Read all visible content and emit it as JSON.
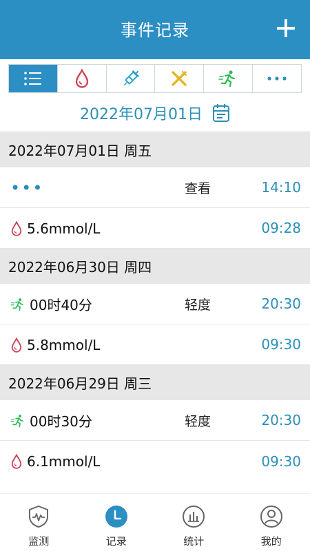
{
  "header": {
    "title": "事件记录",
    "add_icon": "plus-icon"
  },
  "tabs": [
    {
      "icon": "list-icon",
      "active": true
    },
    {
      "icon": "blood-drop-icon",
      "active": false
    },
    {
      "icon": "syringe-icon",
      "active": false
    },
    {
      "icon": "fork-knife-icon",
      "active": false
    },
    {
      "icon": "running-icon",
      "active": false
    },
    {
      "icon": "more-icon",
      "active": false
    }
  ],
  "date_picker": {
    "date": "2022年07月01日",
    "icon": "calendar-icon"
  },
  "days": [
    {
      "header": "2022年07月01日 周五",
      "items": [
        {
          "icon": "more-icon",
          "text": "•••",
          "mid": "查看",
          "time": "14:10"
        },
        {
          "icon": "blood-drop-icon",
          "text": "5.6mmol/L",
          "mid": "",
          "time": "09:28"
        }
      ]
    },
    {
      "header": "2022年06月30日 周四",
      "items": [
        {
          "icon": "running-icon",
          "text": "00时40分",
          "mid": "轻度",
          "time": "20:30"
        },
        {
          "icon": "blood-drop-icon",
          "text": "5.8mmol/L",
          "mid": "",
          "time": "09:30"
        }
      ]
    },
    {
      "header": "2022年06月29日 周三",
      "items": [
        {
          "icon": "running-icon",
          "text": "00时30分",
          "mid": "轻度",
          "time": "20:30"
        },
        {
          "icon": "blood-drop-icon",
          "text": "6.1mmol/L",
          "mid": "",
          "time": "09:30"
        }
      ]
    }
  ],
  "nav": [
    {
      "label": "监测",
      "icon": "heart-monitor-icon",
      "active": false
    },
    {
      "label": "记录",
      "icon": "clock-icon",
      "active": true
    },
    {
      "label": "统计",
      "icon": "bar-chart-icon",
      "active": false
    },
    {
      "label": "我的",
      "icon": "user-icon",
      "active": false
    }
  ],
  "colors": {
    "primary": "#2c8fc4",
    "accent_text": "#2b8fb8",
    "drop": "#d0455a",
    "syringe": "#2aa3c7",
    "food": "#e6b41e",
    "run": "#2dbb57"
  }
}
